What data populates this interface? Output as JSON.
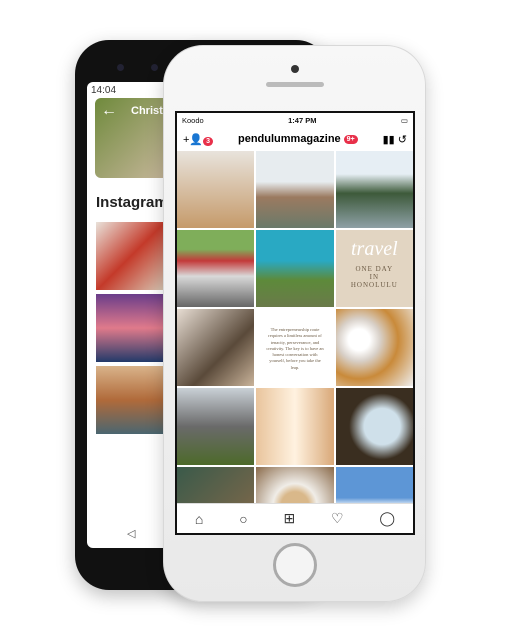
{
  "back_phone": {
    "time": "14:04",
    "header_name": "Christi",
    "section_title": "Instagram"
  },
  "front_phone": {
    "status": {
      "carrier": "Koodo",
      "time": "1:47 PM"
    },
    "header": {
      "notification_count": "3",
      "username": "pendulummagazine",
      "badge": "9+"
    },
    "posts": [
      {
        "text": ""
      },
      {
        "text": ""
      },
      {
        "text": ""
      },
      {
        "text": ""
      },
      {
        "text": ""
      },
      {
        "title_script": "travel",
        "title": "ONE DAY IN HONOLULU"
      },
      {
        "text": ""
      },
      {
        "quote": "The entrepreneurship route requires a limitless amount of tenacity, perseverance, and creativity. The key is to have an honest conversation with yourself, before you take the leap."
      },
      {
        "text": ""
      },
      {
        "text": ""
      },
      {
        "text": ""
      },
      {
        "text": ""
      },
      {
        "text": ""
      },
      {
        "text": ""
      },
      {
        "text": ""
      }
    ],
    "tabs": [
      "home-icon",
      "search-icon",
      "add-icon",
      "heart-icon",
      "profile-icon"
    ],
    "accent": "#e8304a"
  }
}
